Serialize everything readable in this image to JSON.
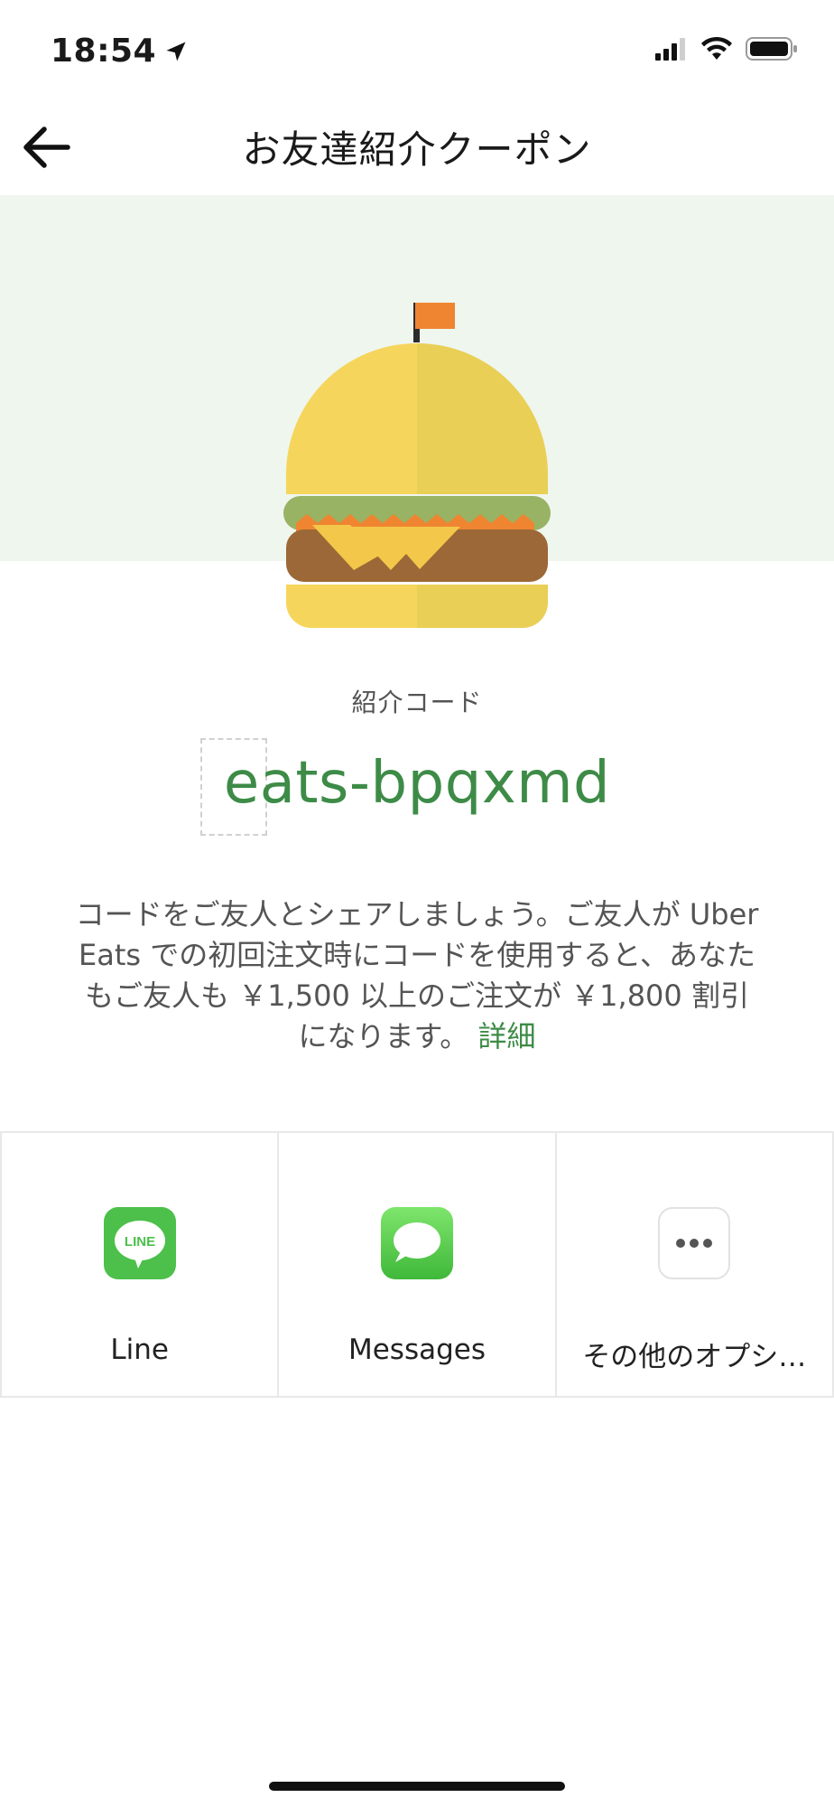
{
  "status_bar": {
    "time": "18:54"
  },
  "header": {
    "title": "お友達紹介クーポン"
  },
  "referral": {
    "code_label": "紹介コード",
    "code": "eats-bpqxmd",
    "description": "コードをご友人とシェアしましょう。ご友人が Uber Eats での初回注文時にコードを使用すると、あなたもご友人も ￥1,500 以上のご注文が ￥1,800 割引になります。",
    "details_link": "詳細"
  },
  "share": {
    "items": [
      {
        "label": "Line",
        "icon": "line-icon"
      },
      {
        "label": "Messages",
        "icon": "messages-icon"
      },
      {
        "label": "その他のオプシ…",
        "icon": "more-options-icon"
      }
    ]
  },
  "colors": {
    "accent_green": "#3d8b47",
    "hero_bg": "#eff6ee"
  }
}
